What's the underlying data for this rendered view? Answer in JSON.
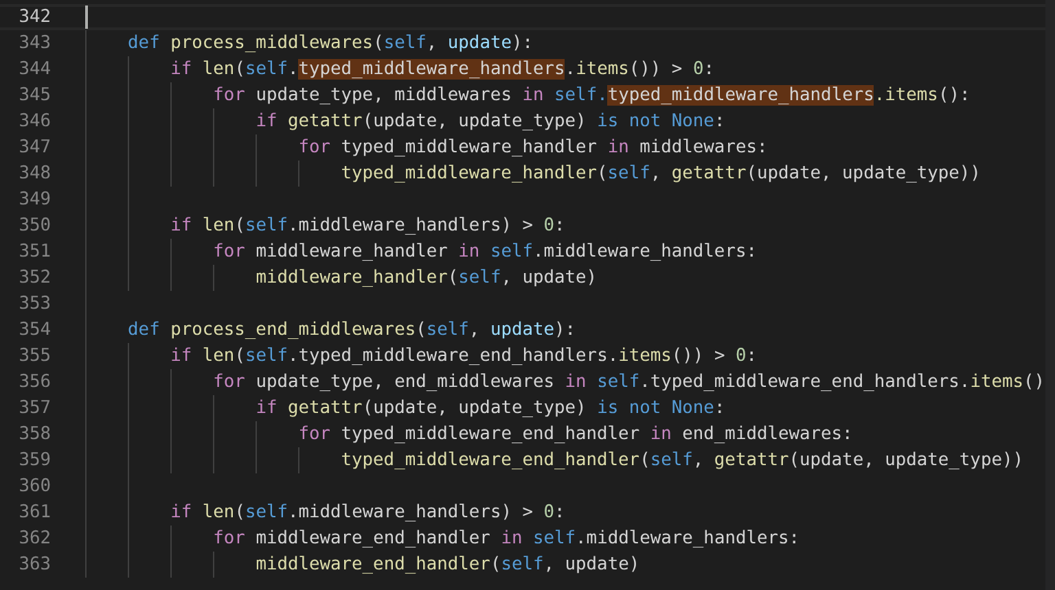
{
  "editor": {
    "lines": [
      {
        "number": "342",
        "current": true
      },
      {
        "number": "343",
        "current": false,
        "tokens": [
          {
            "text": "    def ",
            "kind": "keyword",
            "highlighted": false
          },
          {
            "text": "process_middlewares",
            "kind": "function",
            "highlighted": false
          },
          {
            "text": "(",
            "kind": "plain",
            "highlighted": false
          },
          {
            "text": "self",
            "kind": "keyword",
            "highlighted": false
          },
          {
            "text": ", ",
            "kind": "plain",
            "highlighted": false
          },
          {
            "text": "update",
            "kind": "parameter",
            "highlighted": false
          },
          {
            "text": "):",
            "kind": "plain",
            "highlighted": false
          }
        ]
      },
      {
        "number": "344",
        "current": false,
        "tokens": [
          {
            "text": "        if ",
            "kind": "control",
            "highlighted": false
          },
          {
            "text": "len",
            "kind": "function",
            "highlighted": false
          },
          {
            "text": "(",
            "kind": "plain",
            "highlighted": false
          },
          {
            "text": "self",
            "kind": "keyword",
            "highlighted": false
          },
          {
            "text": ".",
            "kind": "plain",
            "highlighted": false
          },
          {
            "text": "typed_middleware_handlers",
            "kind": "plain",
            "highlighted": true
          },
          {
            "text": ".",
            "kind": "plain",
            "highlighted": false
          },
          {
            "text": "items",
            "kind": "function",
            "highlighted": false
          },
          {
            "text": "()) > ",
            "kind": "plain",
            "highlighted": false
          },
          {
            "text": "0",
            "kind": "number",
            "highlighted": false
          },
          {
            "text": ":",
            "kind": "plain",
            "highlighted": false
          }
        ]
      },
      {
        "number": "345",
        "current": false,
        "tokens": [
          {
            "text": "            for",
            "kind": "control",
            "highlighted": false
          },
          {
            "text": " update_type, middlewares ",
            "kind": "plain",
            "highlighted": false
          },
          {
            "text": "in ",
            "kind": "control",
            "highlighted": false
          },
          {
            "text": "self.",
            "kind": "keyword",
            "highlighted": false
          },
          {
            "text": "typed_middleware_handlers",
            "kind": "plain",
            "highlighted": true
          },
          {
            "text": ".items",
            "kind": "function",
            "highlighted": false
          },
          {
            "text": "():",
            "kind": "plain",
            "highlighted": false
          }
        ]
      },
      {
        "number": "346",
        "current": false,
        "tokens": [
          {
            "text": "                if ",
            "kind": "control",
            "highlighted": false
          },
          {
            "text": "getattr",
            "kind": "function",
            "highlighted": false
          },
          {
            "text": "(update, update_type) ",
            "kind": "plain",
            "highlighted": false
          },
          {
            "text": "is not None",
            "kind": "keyword",
            "highlighted": false
          },
          {
            "text": ":",
            "kind": "plain",
            "highlighted": false
          }
        ]
      },
      {
        "number": "347",
        "current": false,
        "tokens": [
          {
            "text": "                    for",
            "kind": "control",
            "highlighted": false
          },
          {
            "text": " typed_middleware_handler ",
            "kind": "plain",
            "highlighted": false
          },
          {
            "text": "in",
            "kind": "control",
            "highlighted": false
          },
          {
            "text": " middlewares:",
            "kind": "plain",
            "highlighted": false
          }
        ]
      },
      {
        "number": "348",
        "current": false,
        "tokens": [
          {
            "text": "                        typed_middleware_handler",
            "kind": "function",
            "highlighted": false
          },
          {
            "text": "(",
            "kind": "plain",
            "highlighted": false
          },
          {
            "text": "self",
            "kind": "keyword",
            "highlighted": false
          },
          {
            "text": ", ",
            "kind": "plain",
            "highlighted": false
          },
          {
            "text": "getattr",
            "kind": "function",
            "highlighted": false
          },
          {
            "text": "(update, update_type))",
            "kind": "plain",
            "highlighted": false
          }
        ]
      },
      {
        "number": "349",
        "current": false
      },
      {
        "number": "350",
        "current": false,
        "tokens": [
          {
            "text": "        if ",
            "kind": "control",
            "highlighted": false
          },
          {
            "text": "len",
            "kind": "function",
            "highlighted": false
          },
          {
            "text": "(",
            "kind": "plain",
            "highlighted": false
          },
          {
            "text": "self",
            "kind": "keyword",
            "highlighted": false
          },
          {
            "text": ".middleware_handlers) > ",
            "kind": "plain",
            "highlighted": false
          },
          {
            "text": "0",
            "kind": "number",
            "highlighted": false
          },
          {
            "text": ":",
            "kind": "plain",
            "highlighted": false
          }
        ]
      },
      {
        "number": "351",
        "current": false,
        "tokens": [
          {
            "text": "            for",
            "kind": "control",
            "highlighted": false
          },
          {
            "text": " middleware_handler ",
            "kind": "plain",
            "highlighted": false
          },
          {
            "text": "in ",
            "kind": "control",
            "highlighted": false
          },
          {
            "text": "self",
            "kind": "keyword",
            "highlighted": false
          },
          {
            "text": ".middleware_handlers:",
            "kind": "plain",
            "highlighted": false
          }
        ]
      },
      {
        "number": "352",
        "current": false,
        "tokens": [
          {
            "text": "                middleware_handler",
            "kind": "function",
            "highlighted": false
          },
          {
            "text": "(",
            "kind": "plain",
            "highlighted": false
          },
          {
            "text": "self",
            "kind": "keyword",
            "highlighted": false
          },
          {
            "text": ", update)",
            "kind": "plain",
            "highlighted": false
          }
        ]
      },
      {
        "number": "353",
        "current": false
      },
      {
        "number": "354",
        "current": false,
        "tokens": [
          {
            "text": "    def ",
            "kind": "keyword",
            "highlighted": false
          },
          {
            "text": "process_end_middlewares",
            "kind": "function",
            "highlighted": false
          },
          {
            "text": "(",
            "kind": "plain",
            "highlighted": false
          },
          {
            "text": "self",
            "kind": "keyword",
            "highlighted": false
          },
          {
            "text": ", ",
            "kind": "plain",
            "highlighted": false
          },
          {
            "text": "update",
            "kind": "parameter",
            "highlighted": false
          },
          {
            "text": "):",
            "kind": "plain",
            "highlighted": false
          }
        ]
      },
      {
        "number": "355",
        "current": false,
        "tokens": [
          {
            "text": "        if ",
            "kind": "control",
            "highlighted": false
          },
          {
            "text": "len",
            "kind": "function",
            "highlighted": false
          },
          {
            "text": "(",
            "kind": "plain",
            "highlighted": false
          },
          {
            "text": "self",
            "kind": "keyword",
            "highlighted": false
          },
          {
            "text": ".typed_middleware_end_handlers.",
            "kind": "plain",
            "highlighted": false
          },
          {
            "text": "items",
            "kind": "function",
            "highlighted": false
          },
          {
            "text": "()) > ",
            "kind": "plain",
            "highlighted": false
          },
          {
            "text": "0",
            "kind": "number",
            "highlighted": false
          },
          {
            "text": ":",
            "kind": "plain",
            "highlighted": false
          }
        ]
      },
      {
        "number": "356",
        "current": false,
        "tokens": [
          {
            "text": "            for",
            "kind": "control",
            "highlighted": false
          },
          {
            "text": " update_type, end_middlewares ",
            "kind": "plain",
            "highlighted": false
          },
          {
            "text": "in ",
            "kind": "control",
            "highlighted": false
          },
          {
            "text": "self",
            "kind": "keyword",
            "highlighted": false
          },
          {
            "text": ".typed_middleware_end_handlers.",
            "kind": "plain",
            "highlighted": false
          },
          {
            "text": "items",
            "kind": "function",
            "highlighted": false
          },
          {
            "text": "()",
            "kind": "plain",
            "highlighted": false
          }
        ]
      },
      {
        "number": "357",
        "current": false,
        "tokens": [
          {
            "text": "                if ",
            "kind": "control",
            "highlighted": false
          },
          {
            "text": "getattr",
            "kind": "function",
            "highlighted": false
          },
          {
            "text": "(update, update_type) ",
            "kind": "plain",
            "highlighted": false
          },
          {
            "text": "is not None",
            "kind": "keyword",
            "highlighted": false
          },
          {
            "text": ":",
            "kind": "plain",
            "highlighted": false
          }
        ]
      },
      {
        "number": "358",
        "current": false,
        "tokens": [
          {
            "text": "                    for",
            "kind": "control",
            "highlighted": false
          },
          {
            "text": " typed_middleware_end_handler ",
            "kind": "plain",
            "highlighted": false
          },
          {
            "text": "in",
            "kind": "control",
            "highlighted": false
          },
          {
            "text": " end_middlewares:",
            "kind": "plain",
            "highlighted": false
          }
        ]
      },
      {
        "number": "359",
        "current": false,
        "tokens": [
          {
            "text": "                        typed_middleware_end_handler",
            "kind": "function",
            "highlighted": false
          },
          {
            "text": "(",
            "kind": "plain",
            "highlighted": false
          },
          {
            "text": "self",
            "kind": "keyword",
            "highlighted": false
          },
          {
            "text": ", ",
            "kind": "plain",
            "highlighted": false
          },
          {
            "text": "getattr",
            "kind": "function",
            "highlighted": false
          },
          {
            "text": "(update, update_type))",
            "kind": "plain",
            "highlighted": false
          }
        ]
      },
      {
        "number": "360",
        "current": false
      },
      {
        "number": "361",
        "current": false,
        "tokens": [
          {
            "text": "        if ",
            "kind": "control",
            "highlighted": false
          },
          {
            "text": "len",
            "kind": "function",
            "highlighted": false
          },
          {
            "text": "(",
            "kind": "plain",
            "highlighted": false
          },
          {
            "text": "self",
            "kind": "keyword",
            "highlighted": false
          },
          {
            "text": ".middleware_handlers) > ",
            "kind": "plain",
            "highlighted": false
          },
          {
            "text": "0",
            "kind": "number",
            "highlighted": false
          },
          {
            "text": ":",
            "kind": "plain",
            "highlighted": false
          }
        ]
      },
      {
        "number": "362",
        "current": false,
        "tokens": [
          {
            "text": "            for",
            "kind": "control",
            "highlighted": false
          },
          {
            "text": " middleware_end_handler ",
            "kind": "plain",
            "highlighted": false
          },
          {
            "text": "in ",
            "kind": "control",
            "highlighted": false
          },
          {
            "text": "self",
            "kind": "keyword",
            "highlighted": false
          },
          {
            "text": ".middleware_handlers:",
            "kind": "plain",
            "highlighted": false
          }
        ]
      },
      {
        "number": "363",
        "current": false,
        "tokens": [
          {
            "text": "                middleware_end_handler",
            "kind": "function",
            "highlighted": false
          },
          {
            "text": "(",
            "kind": "plain",
            "highlighted": false
          },
          {
            "text": "self",
            "kind": "keyword",
            "highlighted": false
          },
          {
            "text": ", update)",
            "kind": "plain",
            "highlighted": false
          }
        ]
      }
    ]
  }
}
